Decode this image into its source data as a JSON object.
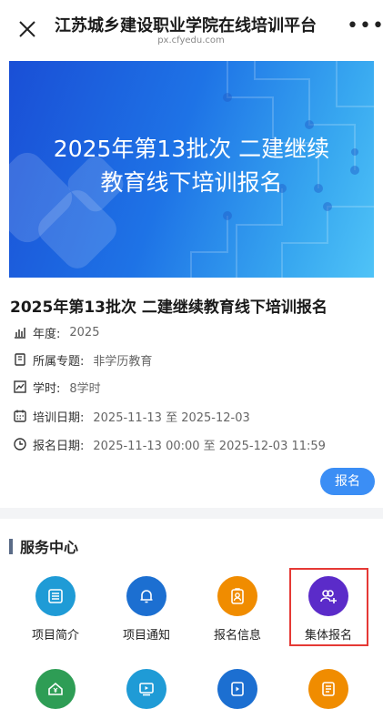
{
  "nav": {
    "title": "江苏城乡建设职业学院在线培训平台",
    "subtitle": "px.cfyedu.com",
    "more": "•••"
  },
  "banner": {
    "line1": "2025年第13批次 二建继续",
    "line2": "教育线下培训报名"
  },
  "course": {
    "title": "2025年第13批次 二建继续教育线下培训报名",
    "rows": [
      {
        "label": "年度:",
        "value": "2025",
        "icon": "bar-chart-icon"
      },
      {
        "label": "所属专题:",
        "value": "非学历教育",
        "icon": "bookmark-icon"
      },
      {
        "label": "学时:",
        "value": "8学时",
        "icon": "line-chart-icon"
      },
      {
        "label": "培训日期:",
        "value": "2025-11-13 至 2025-12-03",
        "icon": "calendar-icon"
      },
      {
        "label": "报名日期:",
        "value": "2025-11-13 00:00 至 2025-12-03 11:59",
        "icon": "clock-icon"
      }
    ],
    "apply_label": "报名"
  },
  "service": {
    "title": "服务中心",
    "tiles": [
      {
        "label": "项目简介",
        "color": "#1f9bd6",
        "icon": "list-icon"
      },
      {
        "label": "项目通知",
        "color": "#1c6fd1",
        "icon": "bell-icon"
      },
      {
        "label": "报名信息",
        "color": "#f08c00",
        "icon": "id-card-icon"
      },
      {
        "label": "集体报名",
        "color": "#5b2bc9",
        "icon": "group-add-icon"
      }
    ],
    "tiles_row2": [
      {
        "color": "#2e9d55",
        "icon": "home-fee-icon"
      },
      {
        "color": "#1f9bd6",
        "icon": "video-icon"
      },
      {
        "color": "#1c6fd1",
        "icon": "doc-play-icon"
      },
      {
        "color": "#f08c00",
        "icon": "form-icon"
      }
    ]
  }
}
